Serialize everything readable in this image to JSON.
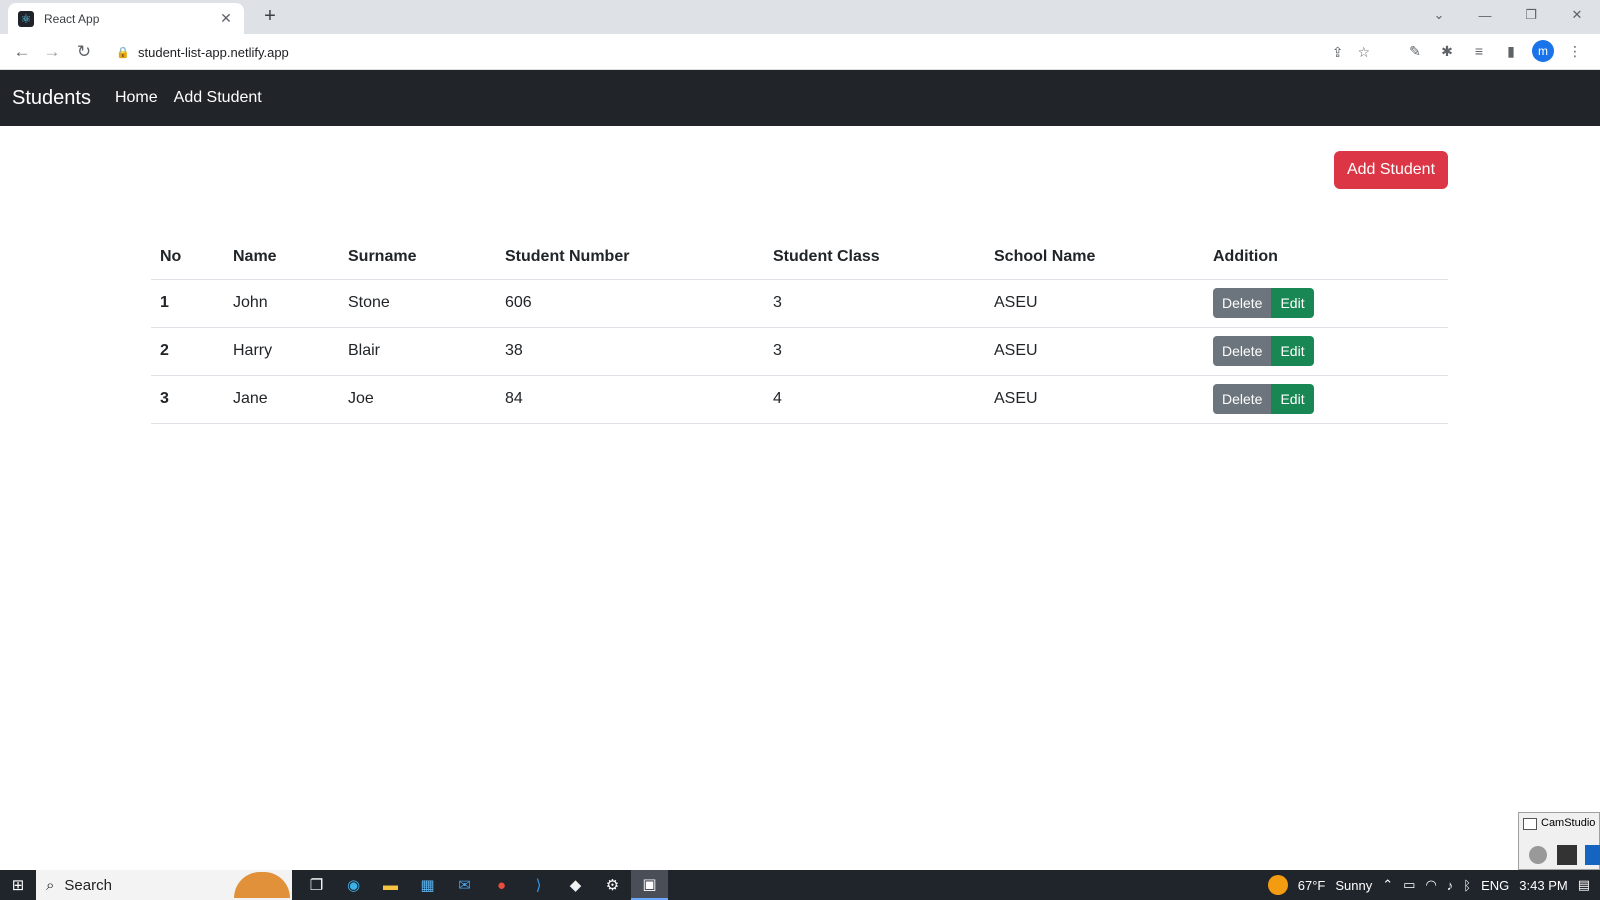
{
  "browser": {
    "tab_title": "React App",
    "favicon": "react-icon",
    "url": "student-list-app.netlify.app",
    "profile_initial": "m"
  },
  "navbar": {
    "brand": "Students",
    "links": [
      "Home",
      "Add Student"
    ]
  },
  "actions": {
    "add_student_label": "Add Student"
  },
  "table": {
    "columns": [
      "No",
      "Name",
      "Surname",
      "Student Number",
      "Student Class",
      "School Name",
      "Addition"
    ],
    "rows": [
      {
        "no": "1",
        "name": "John",
        "surname": "Stone",
        "student_number": "606",
        "student_class": "3",
        "school_name": "ASEU"
      },
      {
        "no": "2",
        "name": "Harry",
        "surname": "Blair",
        "student_number": "38",
        "student_class": "3",
        "school_name": "ASEU"
      },
      {
        "no": "3",
        "name": "Jane",
        "surname": "Joe",
        "student_number": "84",
        "student_class": "4",
        "school_name": "ASEU"
      }
    ],
    "delete_label": "Delete",
    "edit_label": "Edit"
  },
  "camstudio": {
    "title": "CamStudio"
  },
  "taskbar": {
    "search_label": "Search",
    "weather": "67°F",
    "weather_condition": "Sunny",
    "language": "ENG",
    "time": "3:43 PM"
  },
  "colors": {
    "navbar_bg": "#212529",
    "add_button": "#dc3545",
    "delete_button": "#6c757d",
    "edit_button": "#198754"
  }
}
